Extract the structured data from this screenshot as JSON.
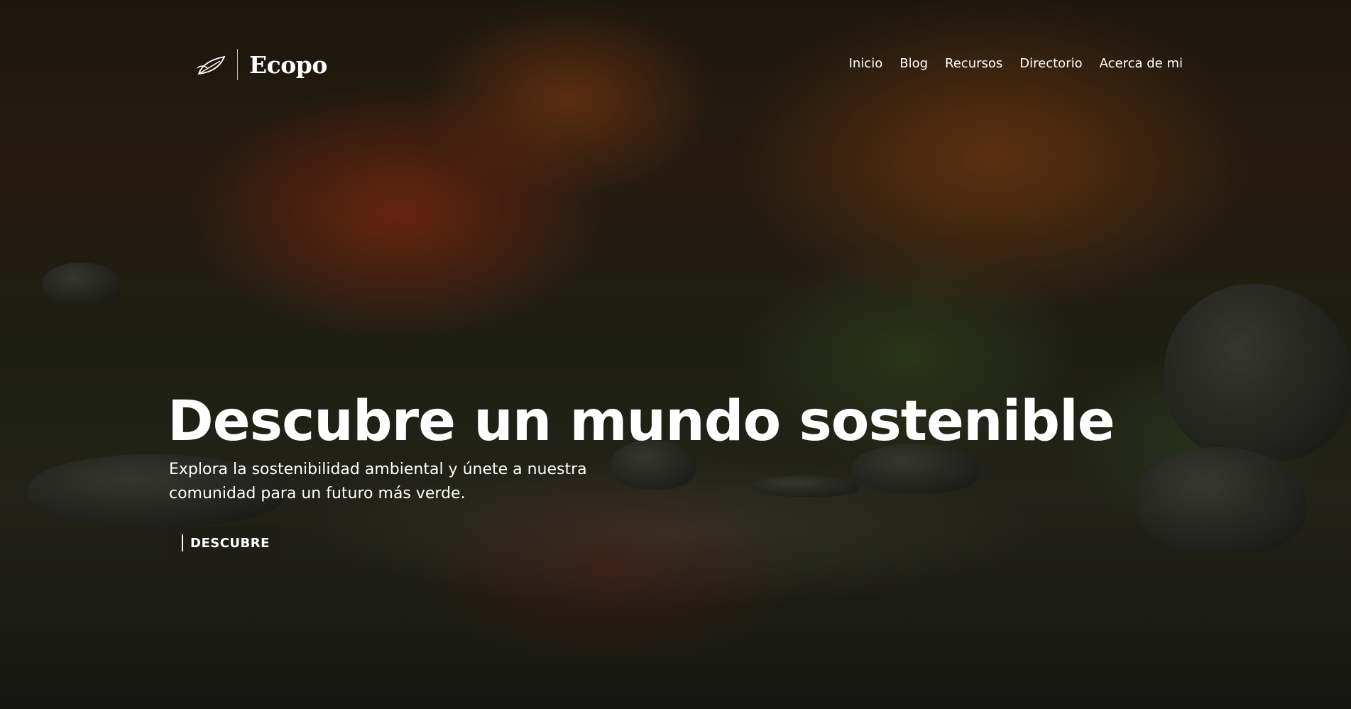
{
  "brand": {
    "name": "Ecopo",
    "logo_icon": "leaf-icon"
  },
  "nav": {
    "items": [
      {
        "label": "Inicio"
      },
      {
        "label": "Blog"
      },
      {
        "label": "Recursos"
      },
      {
        "label": "Directorio"
      },
      {
        "label": "Acerca de mi"
      }
    ]
  },
  "hero": {
    "title": "Descubre un mundo sostenible",
    "subtitle": "Explora la sostenibilidad ambiental y únete a nuestra comunidad para un futuro más verde.",
    "cta_label": "DESCUBRE",
    "background": "photo-of-autumn-japanese-garden-with-pond"
  },
  "colors": {
    "text": "#ffffff",
    "overlay": "rgba(0,0,0,0.35)"
  }
}
